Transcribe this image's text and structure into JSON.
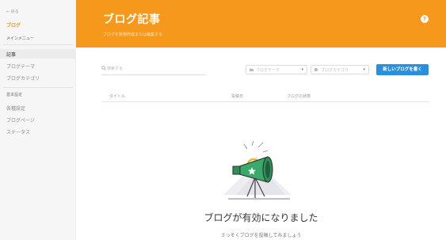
{
  "sidebar": {
    "back_label": "← 戻る",
    "app_label": "ブログ",
    "main_menu_label": "メインメニュー",
    "items": [
      {
        "label": "記事",
        "active": true
      },
      {
        "label": "ブログテーマ",
        "active": false
      },
      {
        "label": "ブログカテゴリ",
        "active": false
      }
    ],
    "settings_section": "基本設定",
    "settings_items": [
      {
        "label": "各種設定"
      },
      {
        "label": "ブログページ"
      },
      {
        "label": "ステータス"
      }
    ]
  },
  "header": {
    "title": "ブログ記事",
    "subtitle": "ブログを新規作成または編集する",
    "help_label": "?",
    "color": "#f6981c"
  },
  "toolbar": {
    "search_placeholder": "検索する",
    "theme_select": "ブログテーマ",
    "category_select": "ブログカテゴリ",
    "new_button": "新しいブログを書く",
    "button_color": "#2b8fdf"
  },
  "table": {
    "columns": [
      "タイトル",
      "投稿日",
      "ブログの状態"
    ]
  },
  "empty_state": {
    "title": "ブログが有効になりました",
    "subtitle": "さっそくブログを投稿してみましょう"
  }
}
